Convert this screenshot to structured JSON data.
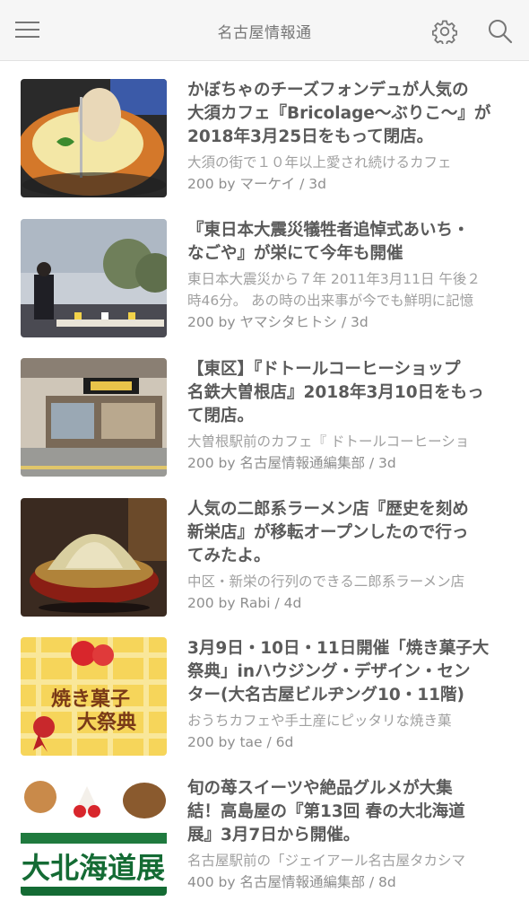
{
  "header": {
    "title": "名古屋情報通",
    "menu_icon": "hamburger-menu-icon",
    "settings_icon": "gear-icon",
    "search_icon": "search-icon"
  },
  "articles": [
    {
      "title": "かぼちゃのチーズフォンデュが人気の\n大須カフェ『Bricolage～ぶりこ～』が\n2018年3月25日をもって閉店。",
      "description": "大須の街で１０年以上愛され続けるカフェ",
      "meta": "200 by マーケイ / 3d",
      "thumbnail": "pumpkin-cheese-fondue-photo"
    },
    {
      "title": "『東日本大震災犠牲者追悼式あいち・\nなごや』が栄にて今年も開催",
      "description": "東日本大震災から７年 2011年3月11日 午後２\n時46分。 あの時の出来事が今でも鮮明に記憶",
      "meta": "200 by ヤマシタヒトシ / 3d",
      "thumbnail": "memorial-ceremony-photo"
    },
    {
      "title": "【東区】『ドトールコーヒーショップ\n名鉄大曽根店』2018年3月10日をもっ\nて閉店。",
      "description": "大曽根駅前のカフェ『 ドトールコーヒーショ",
      "meta": "200 by 名古屋情報通編集部 / 3d",
      "thumbnail": "doutor-storefront-photo"
    },
    {
      "title": "人気の二郎系ラーメン店『歴史を刻め\n新栄店』が移転オープンしたので行っ\nてみたよ。",
      "description": "中区・新栄の行列のできる二郎系ラーメン店",
      "meta": "200 by Rabi / 4d",
      "thumbnail": "jiro-ramen-photo"
    },
    {
      "title": "3月9日・10日・11日開催「焼き菓子大\n祭典」inハウジング・デザイン・セン\nター(大名古屋ビルヂング10・11階)",
      "description": "おうちカフェや手土産にピッタリな焼き菓",
      "meta": "200 by tae / 6d",
      "thumbnail": "baked-sweets-festival-poster",
      "thumb_text": "焼き菓子",
      "thumb_text2": "大祭典"
    },
    {
      "title": "旬の苺スイーツや絶品グルメが大集\n結！高島屋の『第13回 春の大北海道\n展』3月7日から開催。",
      "description": "名古屋駅前の「ジェイアール名古屋タカシマ",
      "meta": "400 by 名古屋情報通編集部 / 8d",
      "thumbnail": "hokkaido-fair-poster",
      "thumb_text": "大北海道展"
    }
  ]
}
